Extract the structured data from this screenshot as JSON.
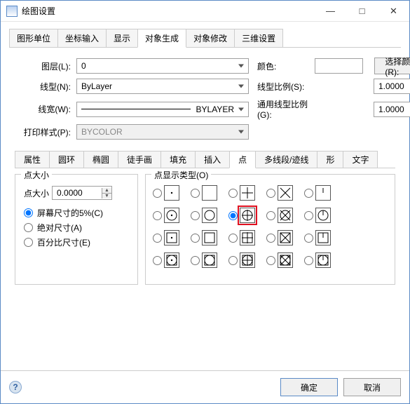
{
  "window": {
    "title": "绘图设置"
  },
  "winbtns": {
    "min": "—",
    "max": "□",
    "close": "✕"
  },
  "main_tabs": {
    "t0": "图形单位",
    "t1": "坐标输入",
    "t2": "显示",
    "t3": "对象生成",
    "t4": "对象修改",
    "t5": "三维设置"
  },
  "form": {
    "layer_lbl": "图层(L):",
    "layer_val": "0",
    "ltype_lbl": "线型(N):",
    "ltype_val": "ByLayer",
    "lweight_lbl": "线宽(W):",
    "lweight_val": "BYLAYER",
    "pstyle_lbl": "打印样式(P):",
    "pstyle_val": "BYCOLOR",
    "color_lbl": "颜色:",
    "color_btn": "选择颜色(R):",
    "ltscale_lbl": "线型比例(S):",
    "ltscale_val": "1.0000",
    "celtscale_lbl": "通用线型比例(G):",
    "celtscale_val": "1.0000"
  },
  "sub_tabs": {
    "s0": "属性",
    "s1": "圆环",
    "s2": "椭圆",
    "s3": "徒手画",
    "s4": "填充",
    "s5": "插入",
    "s6": "点",
    "s7": "多线段/迹线",
    "s8": "形",
    "s9": "文字"
  },
  "point": {
    "size_grp": "点大小",
    "size_lbl": "点大小",
    "size_val": "0.0000",
    "r0": "屏幕尺寸的5%(C)",
    "r1": "绝对尺寸(A)",
    "r2": "百分比尺寸(E)",
    "disp_grp": "点显示类型(O)"
  },
  "footer": {
    "ok": "确定",
    "cancel": "取消",
    "help": "?"
  }
}
